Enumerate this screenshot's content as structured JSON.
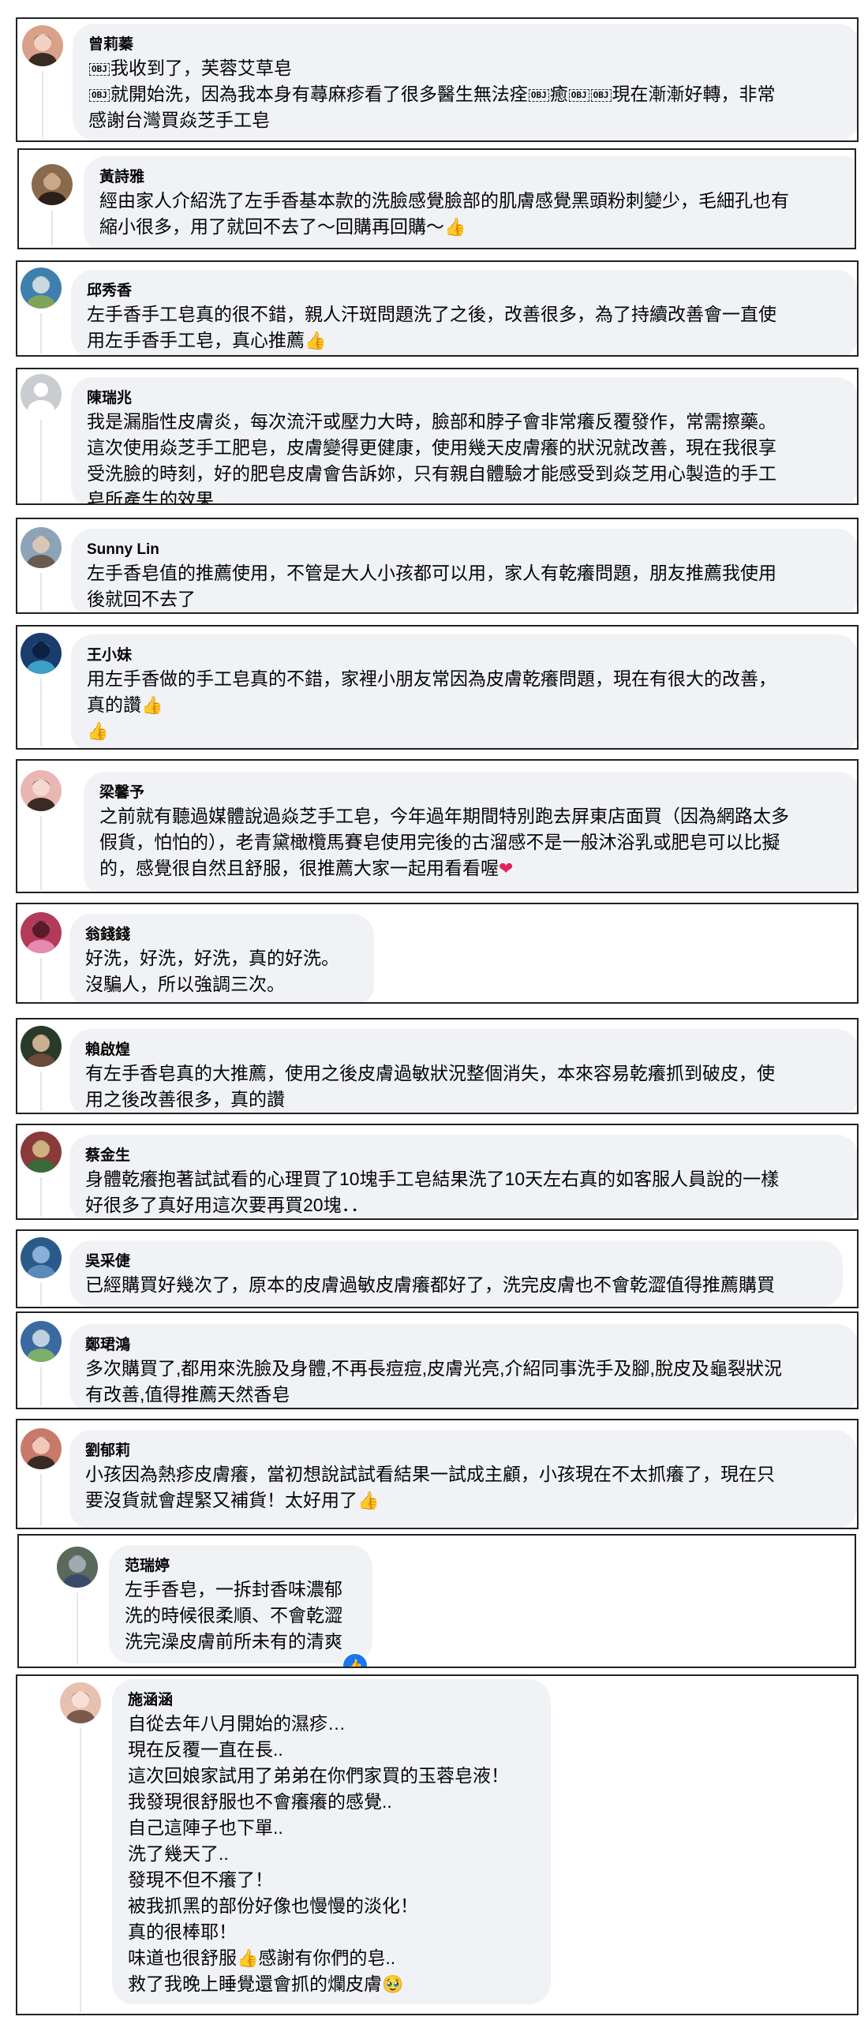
{
  "comments": [
    {
      "name": "曾莉蓁",
      "lines_html": [
        "[OBJ]我收到了，芙蓉艾草皂",
        "[OBJ]就開始洗，因為我本身有蕁麻疹看了很多醫生無法痊[OBJ]癒[OBJ][OBJ]現在漸漸好轉，非常",
        "感謝台灣買焱芝手工皂"
      ]
    },
    {
      "name": "黃詩雅",
      "lines_html": [
        "經由家人介紹洗了左手香基本款的洗臉感覺臉部的肌膚感覺黑頭粉刺變少，毛細孔也有",
        "縮小很多，用了就回不去了～回購再回購～[thumb]"
      ]
    },
    {
      "name": "邱秀香",
      "lines_html": [
        "左手香手工皂真的很不錯，親人汗斑問題洗了之後，改善很多，為了持續改善會一直使",
        "用左手香手工皂，真心推薦[thumb]"
      ]
    },
    {
      "name": "陳瑞兆",
      "lines_html": [
        "我是漏脂性皮膚炎，每次流汗或壓力大時，臉部和脖子會非常癢反覆發作，常需擦藥。",
        "這次使用焱芝手工肥皂，皮膚變得更健康，使用幾天皮膚癢的狀況就改善，現在我很享",
        "受洗臉的時刻，好的肥皂皮膚會告訴妳，只有親自體驗才能感受到焱芝用心製造的手工",
        "皂所產生的效果"
      ]
    },
    {
      "name": "Sunny Lin",
      "lines_html": [
        "左手香皂值的推薦使用，不管是大人小孩都可以用，家人有乾癢問題，朋友推薦我使用",
        "後就回不去了"
      ]
    },
    {
      "name": "王小妹",
      "lines_html": [
        "用左手香做的手工皂真的不錯，家裡小朋友常因為皮膚乾癢問題，現在有很大的改善，",
        "真的讚[thumb]",
        "[thumb]"
      ]
    },
    {
      "name": "梁馨予",
      "lines_html": [
        "之前就有聽過媒體說過焱芝手工皂，今年過年期間特別跑去屏東店面買（因為網路太多",
        "假貨，怕怕的），老青黛橄欖馬賽皂使用完後的古溜感不是一般沐浴乳或肥皂可以比擬",
        "的，感覺很自然且舒服，很推薦大家一起用看看喔[heart]"
      ]
    },
    {
      "name": "翁錢錢",
      "lines_html": [
        "好洗，好洗，好洗，真的好洗。",
        "沒騙人，所以強調三次。"
      ]
    },
    {
      "name": "賴啟煌",
      "lines_html": [
        "有左手香皂真的大推薦，使用之後皮膚過敏狀況整個消失，本來容易乾癢抓到破皮，使",
        "用之後改善很多，真的讚"
      ]
    },
    {
      "name": "蔡金生",
      "lines_html": [
        "身體乾癢抱著試試看的心理買了10塊手工皂結果洗了10天左右真的如客服人員說的一樣",
        "好很多了真好用這次要再買20塊．．"
      ]
    },
    {
      "name": "吳采倢",
      "lines_html": [
        "已經購買好幾次了，原本的皮膚過敏皮膚癢都好了，洗完皮膚也不會乾澀值得推薦購買"
      ]
    },
    {
      "name": "鄭珺鴻",
      "lines_html": [
        "多次購買了,都用來洗臉及身體,不再長痘痘,皮膚光亮,介紹同事洗手及腳,脫皮及龜裂狀況",
        "有改善,值得推薦天然香皂"
      ]
    },
    {
      "name": "劉郁莉",
      "lines_html": [
        "小孩因為熱疹皮膚癢，當初想說試試看結果一試成主顧，小孩現在不太抓癢了，現在只",
        "要沒貨就會趕緊又補貨！太好用了[thumb]"
      ]
    },
    {
      "name": "范瑞婷",
      "lines_html": [
        "左手香皂，一拆封香味濃郁",
        "洗的時候很柔順、不會乾澀",
        "洗完澡皮膚前所未有的清爽"
      ]
    },
    {
      "name": "施涵涵",
      "lines_html": [
        "自從去年八月開始的濕疹…",
        "現在反覆一直在長..",
        "這次回娘家試用了弟弟在你們家買的玉蓉皂液！",
        "我發現很舒服也不會癢癢的感覺..",
        "自己這陣子也下單..",
        "洗了幾天了..",
        "發現不但不癢了！",
        "被我抓黑的部份好像也慢慢的淡化！",
        "真的很棒耶！",
        "味道也很舒服[thumb]感謝有你們的皂..",
        "救了我晚上睡覺還會抓的爛皮膚[face]"
      ]
    }
  ],
  "icons": {
    "obj_placeholder": "OBJ",
    "thumbs_up": "👍",
    "heart": "❤",
    "teary_face": "🥹",
    "like_reaction": "👍"
  },
  "colors": {
    "bubble": "#f0f2f5",
    "card_border": "#222222",
    "like_blue": "#1877f2",
    "thread_line": "#e4e6eb"
  }
}
